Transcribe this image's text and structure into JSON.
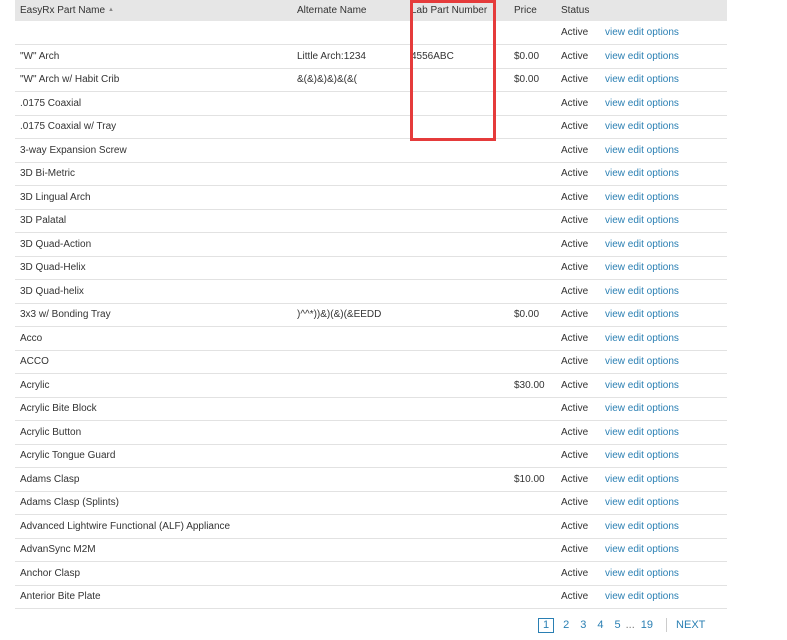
{
  "columns": {
    "name": "EasyRx Part Name",
    "alternate": "Alternate Name",
    "lab_part": "Lab Part Number",
    "price": "Price",
    "status": "Status"
  },
  "sort_icon": "sort-ascending-icon",
  "rows": [
    {
      "name": "",
      "alternate": "",
      "lab_part": "",
      "price": "",
      "status": "Active",
      "options": "view edit options"
    },
    {
      "name": "\"W\" Arch",
      "alternate": "Little Arch:1234",
      "lab_part": "4556ABC",
      "price": "$0.00",
      "status": "Active",
      "options": "view edit options"
    },
    {
      "name": "\"W\" Arch w/ Habit Crib",
      "alternate": "&(&)&)&)&(&(",
      "lab_part": "",
      "price": "$0.00",
      "status": "Active",
      "options": "view edit options"
    },
    {
      "name": ".0175 Coaxial",
      "alternate": "",
      "lab_part": "",
      "price": "",
      "status": "Active",
      "options": "view edit options"
    },
    {
      "name": ".0175 Coaxial w/ Tray",
      "alternate": "",
      "lab_part": "",
      "price": "",
      "status": "Active",
      "options": "view edit options"
    },
    {
      "name": "3-way Expansion Screw",
      "alternate": "",
      "lab_part": "",
      "price": "",
      "status": "Active",
      "options": "view edit options"
    },
    {
      "name": "3D Bi-Metric",
      "alternate": "",
      "lab_part": "",
      "price": "",
      "status": "Active",
      "options": "view edit options"
    },
    {
      "name": "3D Lingual Arch",
      "alternate": "",
      "lab_part": "",
      "price": "",
      "status": "Active",
      "options": "view edit options"
    },
    {
      "name": "3D Palatal",
      "alternate": "",
      "lab_part": "",
      "price": "",
      "status": "Active",
      "options": "view edit options"
    },
    {
      "name": "3D Quad-Action",
      "alternate": "",
      "lab_part": "",
      "price": "",
      "status": "Active",
      "options": "view edit options"
    },
    {
      "name": "3D Quad-Helix",
      "alternate": "",
      "lab_part": "",
      "price": "",
      "status": "Active",
      "options": "view edit options"
    },
    {
      "name": "3D Quad-helix",
      "alternate": "",
      "lab_part": "",
      "price": "",
      "status": "Active",
      "options": "view edit options"
    },
    {
      "name": "3x3 w/ Bonding Tray",
      "alternate": ")^^*))&)(&)(&EEDD",
      "lab_part": "",
      "price": "$0.00",
      "status": "Active",
      "options": "view edit options"
    },
    {
      "name": "Acco",
      "alternate": "",
      "lab_part": "",
      "price": "",
      "status": "Active",
      "options": "view edit options"
    },
    {
      "name": "ACCO",
      "alternate": "",
      "lab_part": "",
      "price": "",
      "status": "Active",
      "options": "view edit options"
    },
    {
      "name": "Acrylic",
      "alternate": "",
      "lab_part": "",
      "price": "$30.00",
      "status": "Active",
      "options": "view edit options"
    },
    {
      "name": "Acrylic Bite Block",
      "alternate": "",
      "lab_part": "",
      "price": "",
      "status": "Active",
      "options": "view edit options"
    },
    {
      "name": "Acrylic Button",
      "alternate": "",
      "lab_part": "",
      "price": "",
      "status": "Active",
      "options": "view edit options"
    },
    {
      "name": "Acrylic Tongue Guard",
      "alternate": "",
      "lab_part": "",
      "price": "",
      "status": "Active",
      "options": "view edit options"
    },
    {
      "name": "Adams Clasp",
      "alternate": "",
      "lab_part": "",
      "price": "$10.00",
      "status": "Active",
      "options": "view edit options"
    },
    {
      "name": "Adams Clasp (Splints)",
      "alternate": "",
      "lab_part": "",
      "price": "",
      "status": "Active",
      "options": "view edit options"
    },
    {
      "name": "Advanced Lightwire Functional (ALF) Appliance",
      "alternate": "",
      "lab_part": "",
      "price": "",
      "status": "Active",
      "options": "view edit options"
    },
    {
      "name": "AdvanSync M2M",
      "alternate": "",
      "lab_part": "",
      "price": "",
      "status": "Active",
      "options": "view edit options"
    },
    {
      "name": "Anchor Clasp",
      "alternate": "",
      "lab_part": "",
      "price": "",
      "status": "Active",
      "options": "view edit options"
    },
    {
      "name": "Anterior Bite Plate",
      "alternate": "",
      "lab_part": "",
      "price": "",
      "status": "Active",
      "options": "view edit options"
    }
  ],
  "pagination": {
    "pages": [
      "1",
      "2",
      "3",
      "4",
      "5"
    ],
    "current": "1",
    "ellipsis": "...",
    "last": "19",
    "next": "NEXT"
  },
  "colors": {
    "link": "#2a7fb3",
    "header_bg": "#e6e6e6",
    "highlight": "#e53b3b"
  }
}
